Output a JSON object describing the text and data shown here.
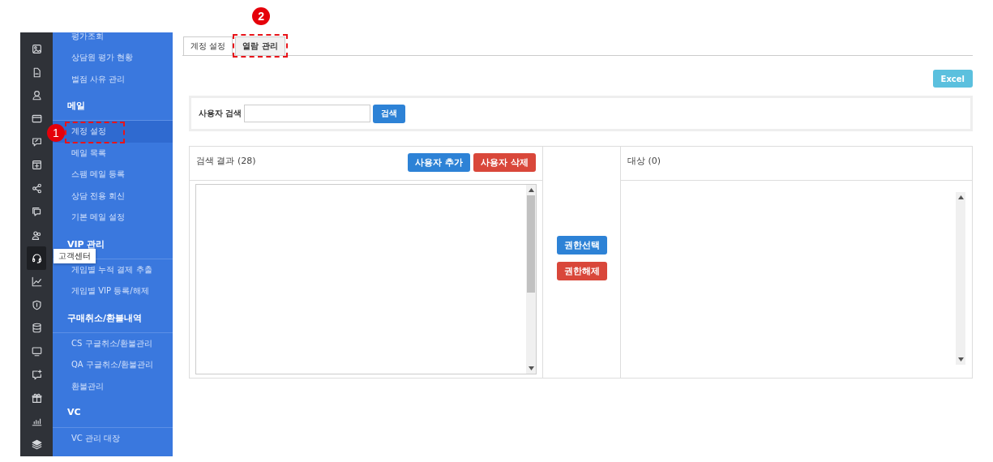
{
  "sidebar": {
    "rail": [
      {
        "kind": "image",
        "selected": false
      },
      {
        "kind": "document",
        "selected": false
      },
      {
        "kind": "user",
        "selected": false
      },
      {
        "kind": "card",
        "selected": false
      },
      {
        "kind": "chat-edit",
        "selected": false
      },
      {
        "kind": "plus-window",
        "selected": false
      },
      {
        "kind": "share",
        "selected": false
      },
      {
        "kind": "chat",
        "selected": false
      },
      {
        "kind": "users",
        "selected": false
      },
      {
        "kind": "headset",
        "selected": true
      },
      {
        "kind": "chart",
        "selected": false
      },
      {
        "kind": "shield",
        "selected": false
      },
      {
        "kind": "database",
        "selected": false
      },
      {
        "kind": "monitor",
        "selected": false
      },
      {
        "kind": "chat-plus",
        "selected": false
      },
      {
        "kind": "gift",
        "selected": false
      },
      {
        "kind": "bar-chart",
        "selected": false
      },
      {
        "kind": "layers",
        "selected": false
      }
    ],
    "tooltip": "고객센터",
    "sections": [
      {
        "items": [
          {
            "label": "평가조회",
            "selected": false
          },
          {
            "label": "상담원 평가 현황",
            "selected": false
          },
          {
            "label": "벌점 사유 관리",
            "selected": false
          }
        ]
      },
      {
        "title": "메일",
        "items": [
          {
            "label": "계정 설정",
            "selected": true,
            "callout": "1"
          },
          {
            "label": "메일 목록",
            "selected": false
          },
          {
            "label": "스팸 메일 등록",
            "selected": false
          },
          {
            "label": "상담 전용 회신",
            "selected": false
          },
          {
            "label": "기본 메일 설정",
            "selected": false
          }
        ]
      },
      {
        "title": "VIP 관리",
        "items": [
          {
            "label": "게임별 누적 결제 추출",
            "selected": false
          },
          {
            "label": "게임별 VIP 등록/해제",
            "selected": false
          }
        ]
      },
      {
        "title": "구매취소/환불내역",
        "items": [
          {
            "label": "CS 구글취소/환불관리",
            "selected": false
          },
          {
            "label": "QA 구글취소/환불관리",
            "selected": false
          },
          {
            "label": "환불관리",
            "selected": false
          }
        ]
      },
      {
        "title": "VC",
        "items": [
          {
            "label": "VC 관리 대장",
            "selected": false
          }
        ]
      }
    ]
  },
  "tabs": [
    {
      "label": "계정 설정",
      "selected": false
    },
    {
      "label": "열람 관리",
      "selected": true,
      "callout": "2"
    }
  ],
  "excel_button": "Excel",
  "search": {
    "label": "사용자 검색",
    "button": "검색"
  },
  "results": {
    "title": "검색 결과 (28)",
    "add_button": "사용자 추가",
    "delete_button": "사용자 삭제"
  },
  "actions": {
    "grant_button": "권한선택",
    "revoke_button": "권한해제"
  },
  "target": {
    "title": "대상 (0)"
  }
}
